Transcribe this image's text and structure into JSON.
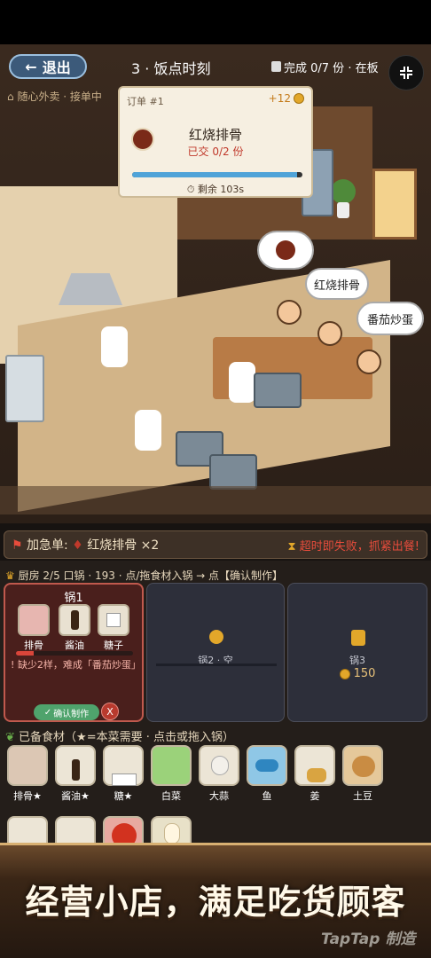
{
  "header": {
    "back_label": "退出",
    "level_title": "3 · 饭点时刻",
    "progress_text": "完成 0/7 份 · 在板",
    "corner_label": "",
    "status": "随心外卖 · 接单中"
  },
  "order": {
    "id": "订单 #1",
    "reward": "+12",
    "dish": "红烧排骨",
    "delivered": "已交 0/2 份",
    "time_fraction": 0.97,
    "remain": "剩余 103s"
  },
  "scene": {
    "bubble_1": "红烧排骨",
    "bubble_2": "番茄炒蛋"
  },
  "rush": {
    "label": "加急单:",
    "dish": "红烧排骨 ×2",
    "warning": "超时即失败，抓紧出餐!"
  },
  "kitchen": {
    "info": "厨房 2/5 口锅 · 193 · 点/拖食材入锅 → 点【确认制作】"
  },
  "pots": {
    "pot1": {
      "title": "锅1",
      "ingredients": [
        "排骨",
        "酱油",
        "糖子"
      ],
      "progress_fraction": 0.15,
      "warning": "! 缺少2样，难成「番茄炒蛋」",
      "confirm_label": "确认制作",
      "cancel_label": "X"
    },
    "pot2": {
      "label": "锅2 · 空"
    },
    "pot3": {
      "label": "锅3",
      "price": "150"
    }
  },
  "stock": {
    "title": "已备食材（★=本菜需要 · 点击或拖入锅）",
    "items": [
      "排骨★",
      "酱油★",
      "糖★",
      "白菜",
      "大蒜",
      "鱼",
      "姜",
      "土豆"
    ]
  },
  "banner": {
    "slogan": "经营小店，满足吃货顾客",
    "watermark": "TapTap 制造"
  },
  "colors": {
    "accent_blue": "#3c5a7a",
    "warning_red": "#e74c3c",
    "coin": "#e2a72a",
    "confirm_green": "#4fa36c"
  }
}
